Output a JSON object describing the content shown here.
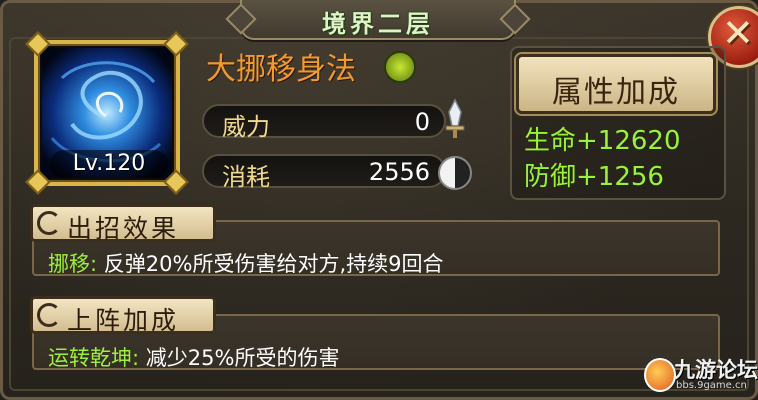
{
  "window": {
    "title": "境界二层"
  },
  "skill": {
    "name": "大挪移身法",
    "level": "Lv.120"
  },
  "stats": [
    {
      "label": "威力",
      "value": "0"
    },
    {
      "label": "消耗",
      "value": "2556"
    }
  ],
  "attributes": {
    "button_label": "属性加成",
    "lines": [
      "生命+12620",
      "防御+1256"
    ]
  },
  "sections": [
    {
      "title": "出招效果",
      "key": "挪移:",
      "text": "反弹20%所受伤害给对方,持续9回合"
    },
    {
      "title": "上阵加成",
      "key": "运转乾坤:",
      "text": "减少25%所受的伤害"
    }
  ],
  "watermark": {
    "text": "九游论坛",
    "url": "bbs.9game.cn"
  },
  "colors": {
    "accent_green": "#9df03e",
    "skill_name_orange": "#f19a2f",
    "label_gold": "#f0d98e"
  },
  "icons": [
    "close-icon",
    "yin-yang-icon",
    "sword-icon",
    "taiji-icon",
    "scroll-icon"
  ]
}
